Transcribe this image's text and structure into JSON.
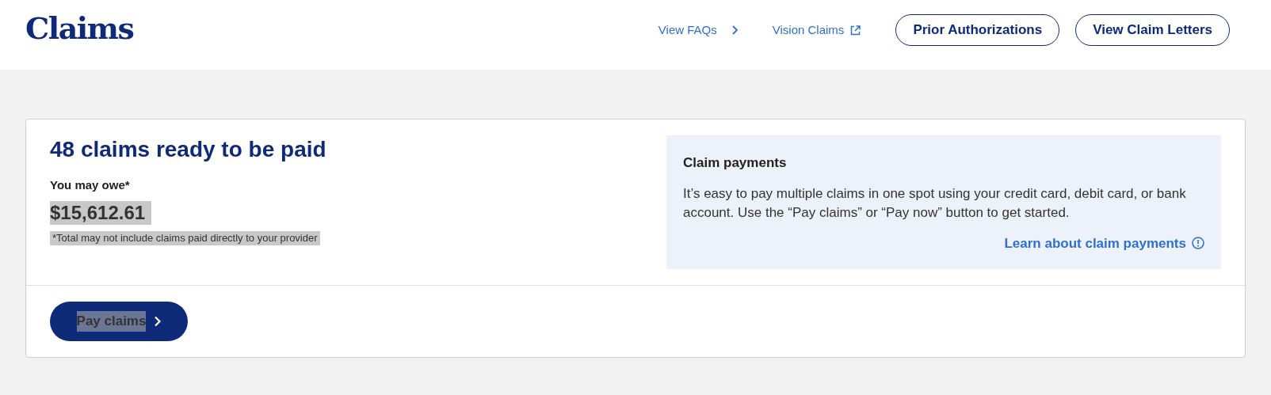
{
  "header": {
    "title": "Claims",
    "links": [
      {
        "label": "View FAQs",
        "kind": "chevron"
      },
      {
        "label": "Vision Claims",
        "kind": "external"
      }
    ],
    "buttons": [
      "Prior Authorizations",
      "View Claim Letters"
    ]
  },
  "summary": {
    "heading": "48 claims ready to be paid",
    "owe_label": "You may owe*",
    "amount": {
      "text": "$15,612.61",
      "highlighted": true
    },
    "note": {
      "text": "*Total may not include claims paid directly to your provider",
      "highlighted": true
    },
    "pay_button": {
      "label": "Pay claims",
      "highlighted": true
    }
  },
  "info": {
    "title": "Claim payments",
    "body": "It’s easy to pay multiple claims in one spot using your credit card, debit card, or bank account. Use the “Pay claims” or “Pay now” button to get started.",
    "link": "Learn about claim payments"
  }
}
